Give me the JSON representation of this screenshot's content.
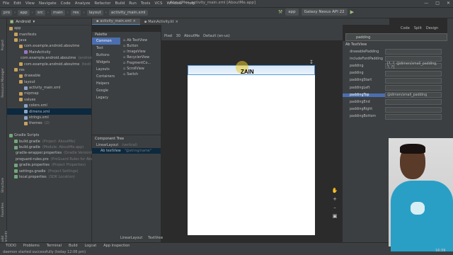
{
  "window": {
    "title": "AboutMe - activity_main.xml [AboutMe.app]",
    "menu": [
      "File",
      "Edit",
      "View",
      "Navigate",
      "Code",
      "Analyze",
      "Refactor",
      "Build",
      "Run",
      "Tools",
      "VCS",
      "Window",
      "Help"
    ]
  },
  "nav": {
    "breadcrumbs": [
      "pro",
      "app",
      "src",
      "main",
      "res",
      "layout",
      "activity_main.xml"
    ],
    "run_config": "app",
    "device": "Galaxy Nexus API 22"
  },
  "project": {
    "view_label": "Android",
    "tree": [
      {
        "label": "app",
        "type": "folder",
        "indent": 0
      },
      {
        "label": "manifests",
        "type": "folder",
        "indent": 1
      },
      {
        "label": "java",
        "type": "folder",
        "indent": 1
      },
      {
        "label": "com.example.android.aboutme",
        "type": "folder",
        "indent": 2
      },
      {
        "label": "MainActivity",
        "type": "kt",
        "indent": 3
      },
      {
        "label": "com.example.android.aboutme",
        "type": "folder",
        "indent": 2,
        "note": "(androidTest)"
      },
      {
        "label": "com.example.android.aboutme",
        "type": "folder",
        "indent": 2,
        "note": "(test)"
      },
      {
        "label": "res",
        "type": "folder",
        "indent": 1
      },
      {
        "label": "drawable",
        "type": "folder",
        "indent": 2
      },
      {
        "label": "layout",
        "type": "folder",
        "indent": 2
      },
      {
        "label": "activity_main.xml",
        "type": "file",
        "indent": 3
      },
      {
        "label": "mipmap",
        "type": "folder",
        "indent": 2
      },
      {
        "label": "values",
        "type": "folder",
        "indent": 2
      },
      {
        "label": "colors.xml",
        "type": "file",
        "indent": 3
      },
      {
        "label": "dimens.xml",
        "type": "file",
        "indent": 3,
        "selected": true
      },
      {
        "label": "strings.xml",
        "type": "file",
        "indent": 3
      },
      {
        "label": "themes",
        "type": "folder",
        "indent": 3,
        "note": "(2)"
      },
      {
        "label": "",
        "type": "blank",
        "indent": 0
      },
      {
        "label": "Gradle Scripts",
        "type": "gradle",
        "indent": 0
      },
      {
        "label": "build.gradle",
        "type": "gradle",
        "indent": 1,
        "note": "(Project: AboutMe)"
      },
      {
        "label": "build.gradle",
        "type": "gradle",
        "indent": 1,
        "note": "(Module: AboutMe.app)"
      },
      {
        "label": "gradle-wrapper.properties",
        "type": "gradle",
        "indent": 1,
        "note": "(Gradle Version)"
      },
      {
        "label": "proguard-rules.pro",
        "type": "gradle",
        "indent": 1,
        "note": "(ProGuard Rules for AboutMe)"
      },
      {
        "label": "gradle.properties",
        "type": "gradle",
        "indent": 1,
        "note": "(Project Properties)"
      },
      {
        "label": "settings.gradle",
        "type": "gradle",
        "indent": 1,
        "note": "(Project Settings)"
      },
      {
        "label": "local.properties",
        "type": "gradle",
        "indent": 1,
        "note": "(SDK Location)"
      }
    ]
  },
  "tabs": [
    {
      "label": "activity_main.xml",
      "active": true
    },
    {
      "label": "MainActivity.kt",
      "active": false
    }
  ],
  "palette": {
    "title": "Palette",
    "categories": [
      "Common",
      "Text",
      "Buttons",
      "Widgets",
      "Layouts",
      "Containers",
      "Helpers",
      "Google",
      "Legacy"
    ],
    "items": [
      "Ab TextView",
      "Button",
      "ImageView",
      "RecyclerView",
      "FragmentCo...",
      "ScrollView",
      "Switch"
    ]
  },
  "component_tree": {
    "title": "Component Tree",
    "items": [
      {
        "label": "LinearLayout",
        "note": "(vertical)"
      },
      {
        "label": "Ab textView",
        "note": "\"@string/name\"",
        "selected": true
      }
    ]
  },
  "design_toolbar": {
    "device": "Pixel",
    "api": "30",
    "theme": "AboutMe",
    "locale": "Default (en-us)"
  },
  "preview": {
    "text": "ZAIN"
  },
  "view_modes": [
    "Code",
    "Split",
    "Design"
  ],
  "attributes": {
    "search": "padding",
    "header": "Ab TextView",
    "rows": [
      {
        "k": "drawablePadding",
        "v": ""
      },
      {
        "k": "includeFontPadding",
        "v": ""
      },
      {
        "k": "padding",
        "v": "[?, ?, @dimen/small_padding, ?, ?]"
      },
      {
        "k": "padding",
        "v": ""
      },
      {
        "k": "paddingStart",
        "v": ""
      },
      {
        "k": "paddingLeft",
        "v": ""
      },
      {
        "k": "paddingTop",
        "v": "@dimen/small_padding",
        "selected": true
      },
      {
        "k": "paddingEnd",
        "v": ""
      },
      {
        "k": "paddingRight",
        "v": ""
      },
      {
        "k": "paddingBottom",
        "v": ""
      }
    ]
  },
  "bottom_tools": [
    "TODO",
    "Problems",
    "Terminal",
    "Build",
    "Logcat",
    "App Inspection"
  ],
  "bottom_breadcrumb": [
    "LinearLayout",
    "TextView"
  ],
  "status": "daemon started successfully (today 12:06 pm)",
  "clock": "16:39"
}
